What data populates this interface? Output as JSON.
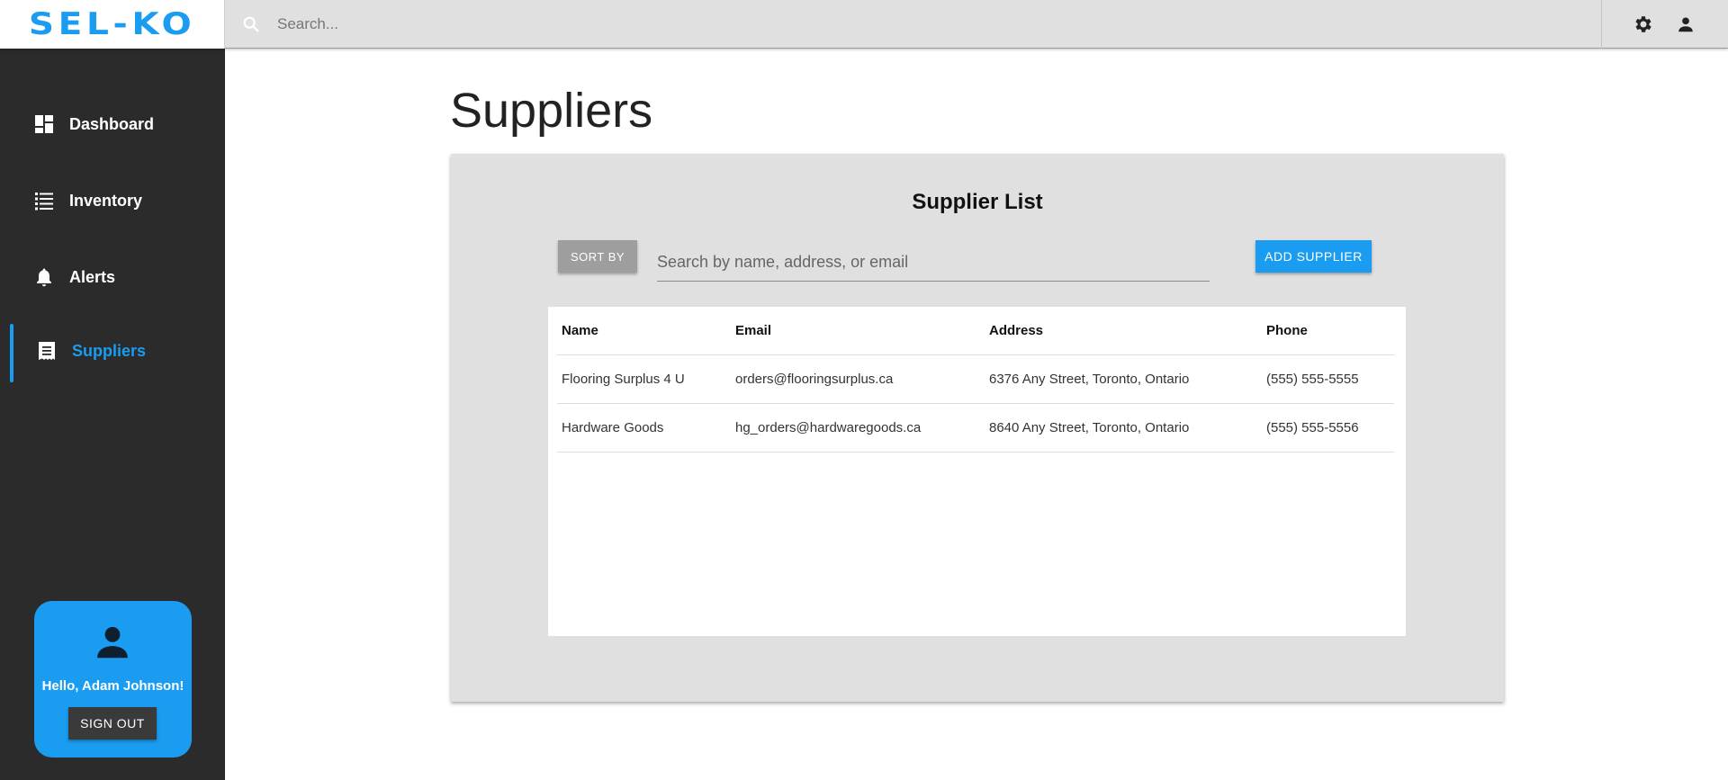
{
  "app": {
    "logo": "SEL-KO",
    "accent": "#1a9cf0"
  },
  "header": {
    "search_placeholder": "Search...",
    "icons": [
      "search-icon",
      "gear-icon",
      "person-icon"
    ]
  },
  "sidebar": {
    "items": [
      {
        "label": "Dashboard",
        "icon": "dashboard-icon",
        "active": false
      },
      {
        "label": "Inventory",
        "icon": "list-icon",
        "active": false
      },
      {
        "label": "Alerts",
        "icon": "bell-icon",
        "active": false
      },
      {
        "label": "Suppliers",
        "icon": "receipt-icon",
        "active": true
      }
    ],
    "user": {
      "greeting": "Hello, Adam Johnson!",
      "sign_out_label": "SIGN OUT"
    }
  },
  "main": {
    "page_title": "Suppliers",
    "card": {
      "title": "Supplier List",
      "sort_label": "SORT BY",
      "filter_placeholder": "Search by name, address, or email",
      "add_label": "ADD SUPPLIER",
      "columns": [
        "Name",
        "Email",
        "Address",
        "Phone"
      ],
      "rows": [
        [
          "Flooring Surplus 4 U",
          "orders@flooringsurplus.ca",
          "6376 Any Street, Toronto, Ontario",
          "(555) 555-5555"
        ],
        [
          "Hardware Goods",
          "hg_orders@hardwaregoods.ca",
          "8640 Any Street, Toronto, Ontario",
          "(555) 555-5556"
        ]
      ]
    }
  }
}
